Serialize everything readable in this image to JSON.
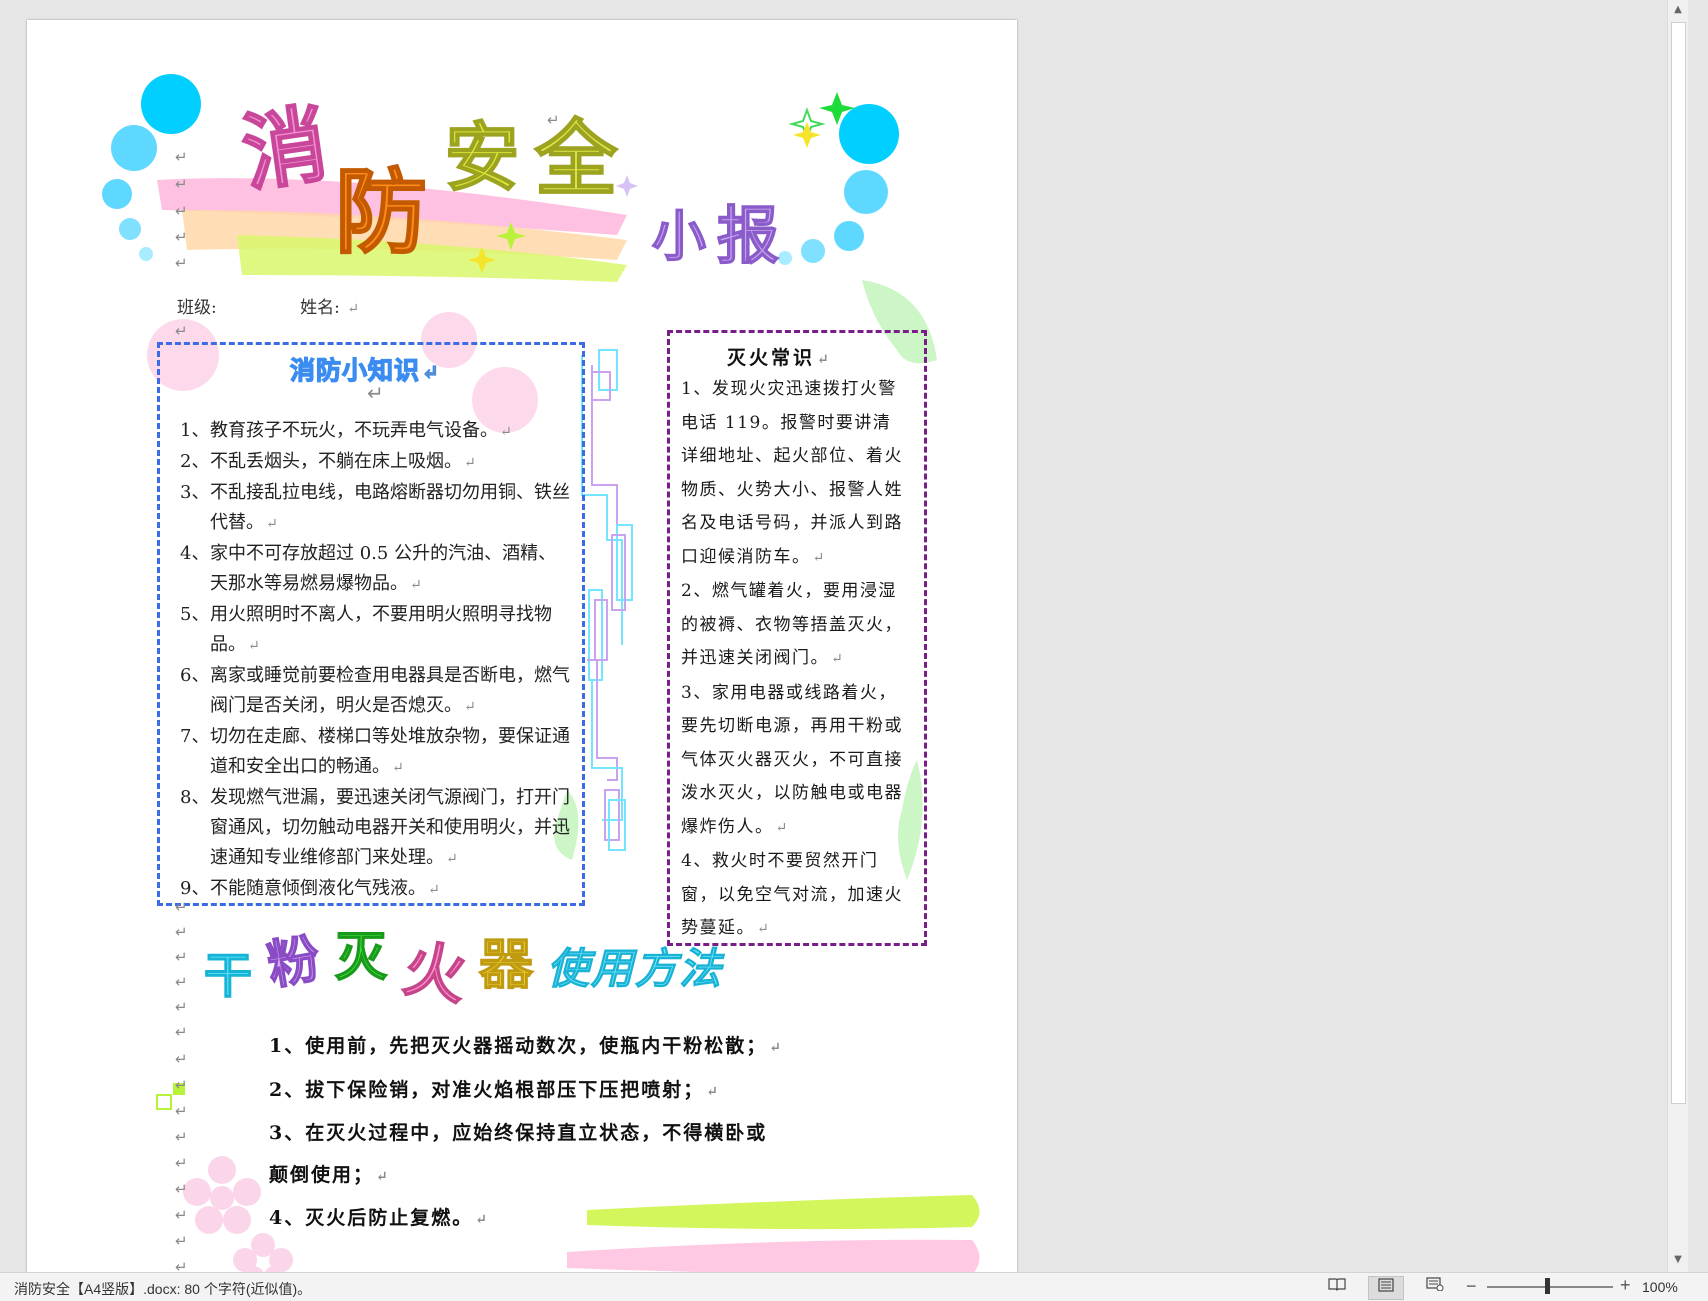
{
  "document": {
    "title_main": [
      "消",
      "防",
      "安",
      "全"
    ],
    "title_sub": [
      "小",
      "报"
    ],
    "class_label": "班级:",
    "name_label": "姓名:",
    "return_mark": "↵"
  },
  "knowledge_box": {
    "heading": "消防小知识",
    "items": [
      {
        "num": "1、",
        "text": "教育孩子不玩火，不玩弄电气设备。"
      },
      {
        "num": "2、",
        "text": "不乱丢烟头，不躺在床上吸烟。"
      },
      {
        "num": "3、",
        "text": "不乱接乱拉电线，电路熔断器切勿用铜、铁丝代替。"
      },
      {
        "num": "4、",
        "text": "家中不可存放超过  0.5 公升的汽油、酒精、天那水等易燃易爆物品。"
      },
      {
        "num": "5、",
        "text": "用火照明时不离人，不要用明火照明寻找物品。"
      },
      {
        "num": "6、",
        "text": "离家或睡觉前要检查用电器具是否断电，燃气阀门是否关闭，明火是否熄灭。"
      },
      {
        "num": "7、",
        "text": "切勿在走廊、楼梯口等处堆放杂物，要保证通道和安全出口的畅通。"
      },
      {
        "num": "8、",
        "text": "发现燃气泄漏，要迅速关闭气源阀门，打开门窗通风，切勿触动电器开关和使用明火，并迅速通知专业维修部门来处理。"
      },
      {
        "num": "9、",
        "text": "不能随意倾倒液化气残液。"
      }
    ]
  },
  "extinguish_box": {
    "heading": "灭火常识",
    "items": [
      "1、发现火灾迅速拨打火警电话 119。报警时要讲清详细地址、起火部位、着火物质、火势大小、报警人姓名及电话号码，并派人到路口迎候消防车。",
      "2、燃气罐着火，要用浸湿的被褥、衣物等捂盖灭火，并迅速关闭阀门。",
      "3、家用电器或线路着火，要先切断电源，再用干粉或气体灭火器灭火，不可直接泼水灭火，以防触电或电器爆炸伤人。",
      "4、救火时不要贸然开门窗，以免空气对流，加速火势蔓延。"
    ]
  },
  "usage_section": {
    "heading_chars": [
      "干",
      "粉",
      "灭",
      "火",
      "器"
    ],
    "heading_rest": "使用方法",
    "lines": [
      "1、使用前，先把灭火器摇动数次，使瓶内干粉松散；",
      "2、拔下保险销，对准火焰根部压下压把喷射；",
      "3、在灭火过程中，应始终保持直立状态，不得横卧或",
      "颠倒使用；",
      "4、灭火后防止复燃。"
    ]
  },
  "status_bar": {
    "doc_info": "消防安全【A4竖版】.docx: 80 个字符(近似值)。",
    "zoom_minus": "−",
    "zoom_plus": "+",
    "zoom_level": "100%",
    "icons": [
      "read-mode-icon",
      "print-layout-icon",
      "web-layout-icon"
    ]
  },
  "colors": {
    "title_pink": "#f48fd0",
    "title_orange": "#ff8c1a",
    "title_yellow": "#e0e64a",
    "sub_purple": "#b58be6",
    "cyan": "#00cfff",
    "blue_border": "#3b6ce6",
    "purple_border": "#7a1c8a"
  }
}
